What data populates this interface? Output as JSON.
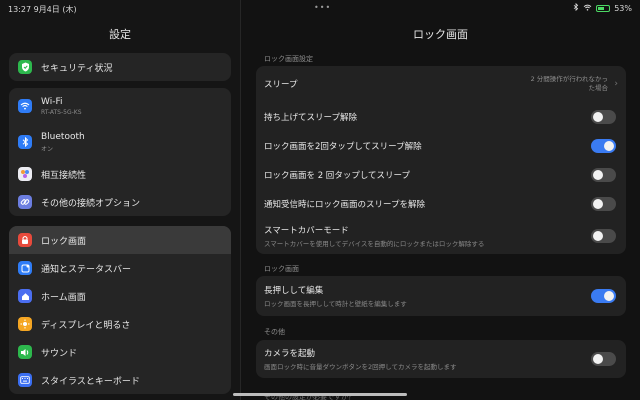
{
  "status": {
    "time": "13:27 9月4日 (木)",
    "dots": "•••",
    "battery": "53%",
    "icons": [
      "bluetooth-icon",
      "wifi-icon",
      "battery-icon"
    ]
  },
  "left": {
    "title": "設定",
    "groups": [
      {
        "items": [
          {
            "label": "セキュリティ状況",
            "icon": "shield-icon",
            "color": "#2db84d"
          }
        ]
      },
      {
        "items": [
          {
            "label": "Wi-Fi",
            "sub": "RT-ATS-5G-KS",
            "icon": "wifi-icon",
            "color": "#2f7cf6"
          },
          {
            "label": "Bluetooth",
            "sub": "オン",
            "icon": "bluetooth-icon",
            "color": "#2f7cf6"
          },
          {
            "label": "相互接続性",
            "icon": "interconnect-icon",
            "color": "#e8e8f0"
          },
          {
            "label": "その他の接続オプション",
            "icon": "link-icon",
            "color": "#6c7ee0"
          }
        ]
      },
      {
        "items": [
          {
            "label": "ロック画面",
            "icon": "lock-icon",
            "color": "#e84a3c"
          },
          {
            "label": "通知とステータスバー",
            "icon": "notification-icon",
            "color": "#2f7cf6"
          },
          {
            "label": "ホーム画面",
            "icon": "home-icon",
            "color": "#4b6ef0"
          },
          {
            "label": "ディスプレイと明るさ",
            "icon": "sun-icon",
            "color": "#f5a623"
          },
          {
            "label": "サウンド",
            "icon": "sound-icon",
            "color": "#2db84d"
          },
          {
            "label": "スタイラスとキーボード",
            "icon": "keyboard-icon",
            "color": "#3b6ff2"
          }
        ]
      }
    ]
  },
  "right": {
    "title": "ロック画面",
    "section1": "ロック画面設定",
    "sleep": {
      "label": "スリープ",
      "value": "2 分間操作が行われなかった場合"
    },
    "rows1": [
      {
        "label": "持ち上げてスリープ解除",
        "on": false
      },
      {
        "label": "ロック画面を2回タップしてスリープ解除",
        "on": true
      },
      {
        "label": "ロック画面を 2 回タップしてスリープ",
        "on": false
      },
      {
        "label": "通知受信時にロック画面のスリープを解除",
        "on": false
      }
    ],
    "smartcover": {
      "label": "スマートカバーモード",
      "sub": "スマートカバーを使用してデバイスを自動的にロックまたはロック解除する",
      "on": false
    },
    "section2": "ロック画面",
    "longpress": {
      "label": "長押しして編集",
      "sub": "ロック画面を長押しして時計と壁紙を編集します",
      "on": true
    },
    "section3": "その他",
    "camera": {
      "label": "カメラを起動",
      "sub": "画面ロック時に音量ダウンボタンを2回押してカメラを起動します",
      "on": false
    },
    "peek": "その他の設定が必要ですか？"
  }
}
